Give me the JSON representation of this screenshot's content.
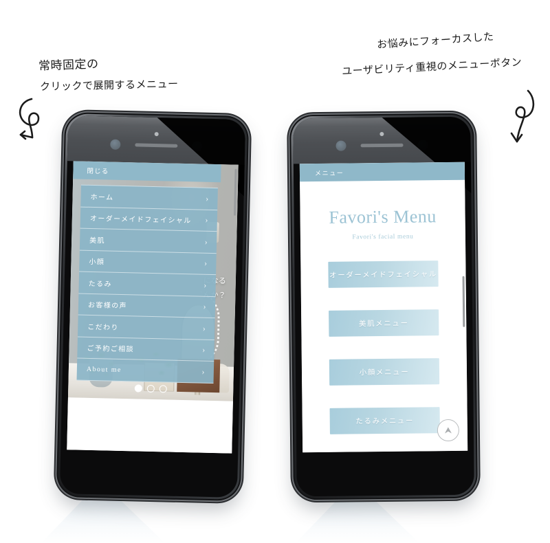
{
  "annotations": {
    "left_line1": "常時固定の",
    "left_line2": "クリックで展開するメニュー",
    "right_line1": "お悩みにフォーカスした",
    "right_line2": "ユーザビリティ重視のメニューボタン",
    "arrow_left_icon": "curly-arrow-down-left-icon",
    "arrow_right_icon": "curly-arrow-down-icon"
  },
  "colors": {
    "accent_blue": "#8fb8c9",
    "button_blue_start": "#a8cddc",
    "button_blue_end": "#d6e9f0",
    "title_blue": "#9cc3d4",
    "phone_body": "#111214",
    "phone_rim": "#6d7074",
    "page_background": "#ffffff"
  },
  "left_phone": {
    "drawer": {
      "close_label": "閉じる",
      "chevron_icon": "chevron-right-icon",
      "items": [
        {
          "label": "ホーム"
        },
        {
          "label": "オーダーメイドフェイシャル"
        },
        {
          "label": "美肌"
        },
        {
          "label": "小顔"
        },
        {
          "label": "たるみ"
        },
        {
          "label": "お客様の声"
        },
        {
          "label": "こだわり"
        },
        {
          "label": "ご予約ご相談"
        },
        {
          "label": "About me"
        }
      ]
    },
    "hero": {
      "line1": "になる",
      "line2": "んか？"
    },
    "carousel": {
      "total_dots": 3,
      "active_index": 0
    }
  },
  "right_phone": {
    "header_label": "メニュー",
    "title": "Favori's Menu",
    "subtitle": "Favori's facial menu",
    "buttons": [
      {
        "label": "オーダーメイドフェイシャル"
      },
      {
        "label": "美肌メニュー"
      },
      {
        "label": "小顔メニュー"
      },
      {
        "label": "たるみメニュー"
      }
    ],
    "to_top_icon": "scroll-to-top-icon"
  }
}
